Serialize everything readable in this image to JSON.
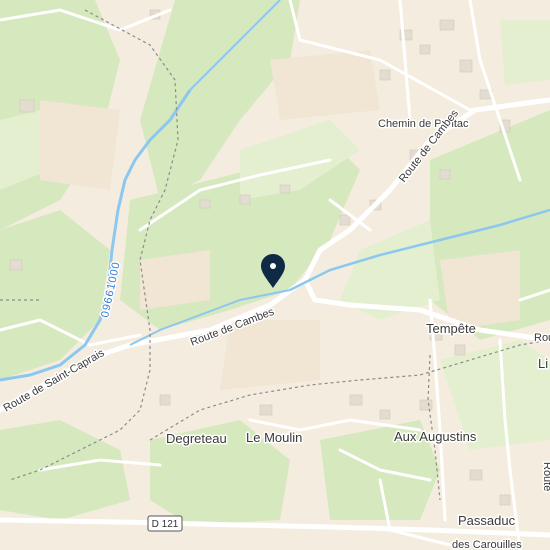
{
  "map": {
    "marker": {
      "name": "location-pin"
    },
    "places": [
      {
        "id": "tempete",
        "label": "Tempête"
      },
      {
        "id": "degreteau",
        "label": "Degreteau"
      },
      {
        "id": "le-moulin",
        "label": "Le Moulin"
      },
      {
        "id": "aux-augustins",
        "label": "Aux Augustins"
      },
      {
        "id": "passaduc",
        "label": "Passaduc"
      },
      {
        "id": "li-partial",
        "label": "Li"
      }
    ],
    "roads": [
      {
        "id": "chemin-de-pontac",
        "label": "Chemin de Pontac"
      },
      {
        "id": "route-de-cambes-north",
        "label": "Route de Cambes"
      },
      {
        "id": "route-de-cambes-south",
        "label": "Route de Cambes"
      },
      {
        "id": "route-de-saint-caprais",
        "label": "Route de Saint-Caprais"
      },
      {
        "id": "des-carouilles",
        "label": "des Carouilles"
      },
      {
        "id": "route-right-edge",
        "label": "Route"
      },
      {
        "id": "route-bottom-right",
        "label": "Route"
      }
    ],
    "road_shield": {
      "label": "D 121"
    },
    "waterway": {
      "label": "09661000"
    },
    "colors": {
      "background": "#f4eddf",
      "forest": "#d6e8bd",
      "meadow": "#e3efcf",
      "water": "#8cc7f0",
      "road": "#ffffff",
      "boundary": "#8c8c8c",
      "marker": "#0f2a44",
      "building": "#e3ddd1"
    }
  }
}
